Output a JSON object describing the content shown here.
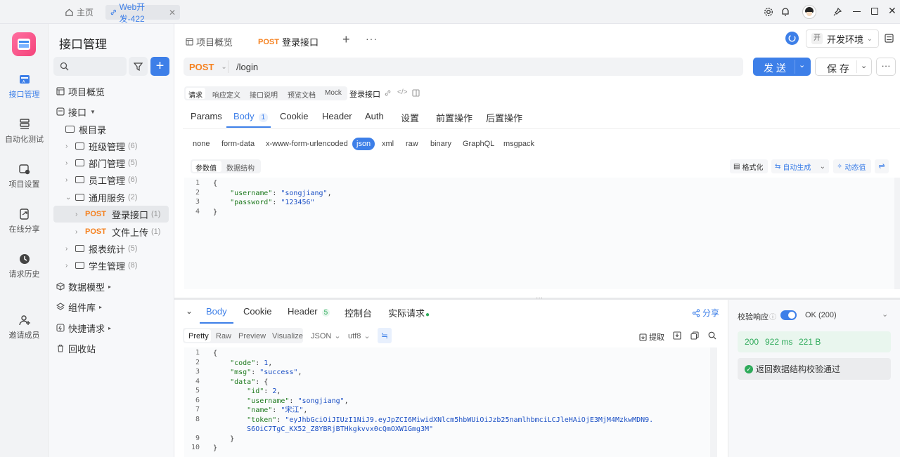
{
  "window": {
    "home_label": "主页",
    "active_tab": "Web开发-422"
  },
  "rail": {
    "items": [
      {
        "label": "接口管理"
      },
      {
        "label": "自动化测试"
      },
      {
        "label": "项目设置"
      },
      {
        "label": "在线分享"
      },
      {
        "label": "请求历史"
      },
      {
        "label": "邀请成员"
      }
    ]
  },
  "sidebar": {
    "title": "接口管理",
    "search_placeholder": "",
    "items": {
      "overview": "项目概览",
      "api_root": "接口",
      "root_dir": "根目录",
      "class_mgmt": "班级管理",
      "class_cnt": "(6)",
      "dept_mgmt": "部门管理",
      "dept_cnt": "(5)",
      "emp_mgmt": "员工管理",
      "emp_cnt": "(6)",
      "common": "通用服务",
      "common_cnt": "(2)",
      "login_method": "POST",
      "login": "登录接口",
      "login_cnt": "(1)",
      "upload_method": "POST",
      "upload": "文件上传",
      "upload_cnt": "(1)",
      "report": "报表统计",
      "report_cnt": "(5)",
      "student": "学生管理",
      "student_cnt": "(8)",
      "models": "数据模型",
      "components": "组件库",
      "quick": "快捷请求",
      "trash": "回收站"
    }
  },
  "doc_tabs": {
    "overview": "项目概览",
    "active_method": "POST",
    "active": "登录接口"
  },
  "env": {
    "badge": "开",
    "label": "开发环境"
  },
  "request": {
    "method": "POST",
    "url": "/login",
    "send": "发 送",
    "save": "保 存"
  },
  "mode_tabs": [
    "请求",
    "响应定义",
    "接口说明",
    "预览文档",
    "Mock"
  ],
  "mode_title": "登录接口",
  "param_tabs": {
    "params": "Params",
    "body": "Body",
    "body_count": "1",
    "cookie": "Cookie",
    "header": "Header",
    "auth": "Auth",
    "settings": "设置",
    "pre": "前置操作",
    "post": "后置操作"
  },
  "body_types": [
    "none",
    "form-data",
    "x-www-form-urlencoded",
    "json",
    "xml",
    "raw",
    "binary",
    "GraphQL",
    "msgpack"
  ],
  "body_active": "json",
  "editor_tabs": {
    "values": "参数值",
    "schema": "数据结构",
    "format": "格式化",
    "auto": "自动生成",
    "dynamic": "动态值"
  },
  "request_body": [
    "{",
    "    \"username\": \"songjiang\",",
    "    \"password\": \"123456\"",
    "}"
  ],
  "response": {
    "tabs": {
      "body": "Body",
      "cookie": "Cookie",
      "header": "Header",
      "header_count": "5",
      "console": "控制台",
      "actual": "实际请求"
    },
    "share": "分享",
    "views": [
      "Pretty",
      "Raw",
      "Preview",
      "Visualize"
    ],
    "format": "JSON",
    "encoding": "utf8",
    "extract": "提取",
    "lines": [
      "{",
      "    \"code\": 1,",
      "    \"msg\": \"success\",",
      "    \"data\": {",
      "        \"id\": 2,",
      "        \"username\": \"songjiang\",",
      "        \"name\": \"宋江\",",
      "        \"token\": \"eyJhbGciOiJIUzI1NiJ9.eyJpZCI6MiwidXNlcm5hbWUiOiJzb25namlhbmciLCJleHAiOjE3MjM4MzkwMDN9.",
      "        S6OiC7TgC_KX52_Z8YBRjBTHkgkvvx0cQmOXW1Gmg3M\"",
      "    }",
      "}"
    ],
    "line_numbers": [
      "1",
      "2",
      "3",
      "4",
      "5",
      "6",
      "7",
      "8",
      "",
      "9",
      "10"
    ]
  },
  "validation": {
    "label": "校验响应",
    "ok": "OK (200)",
    "status": "200",
    "time": "922 ms",
    "size": "221 B",
    "result": "返回数据结构校验通过"
  },
  "colors": {
    "accent": "#3d7fe8",
    "post": "#f5811f",
    "ok": "#2eaa5a"
  }
}
